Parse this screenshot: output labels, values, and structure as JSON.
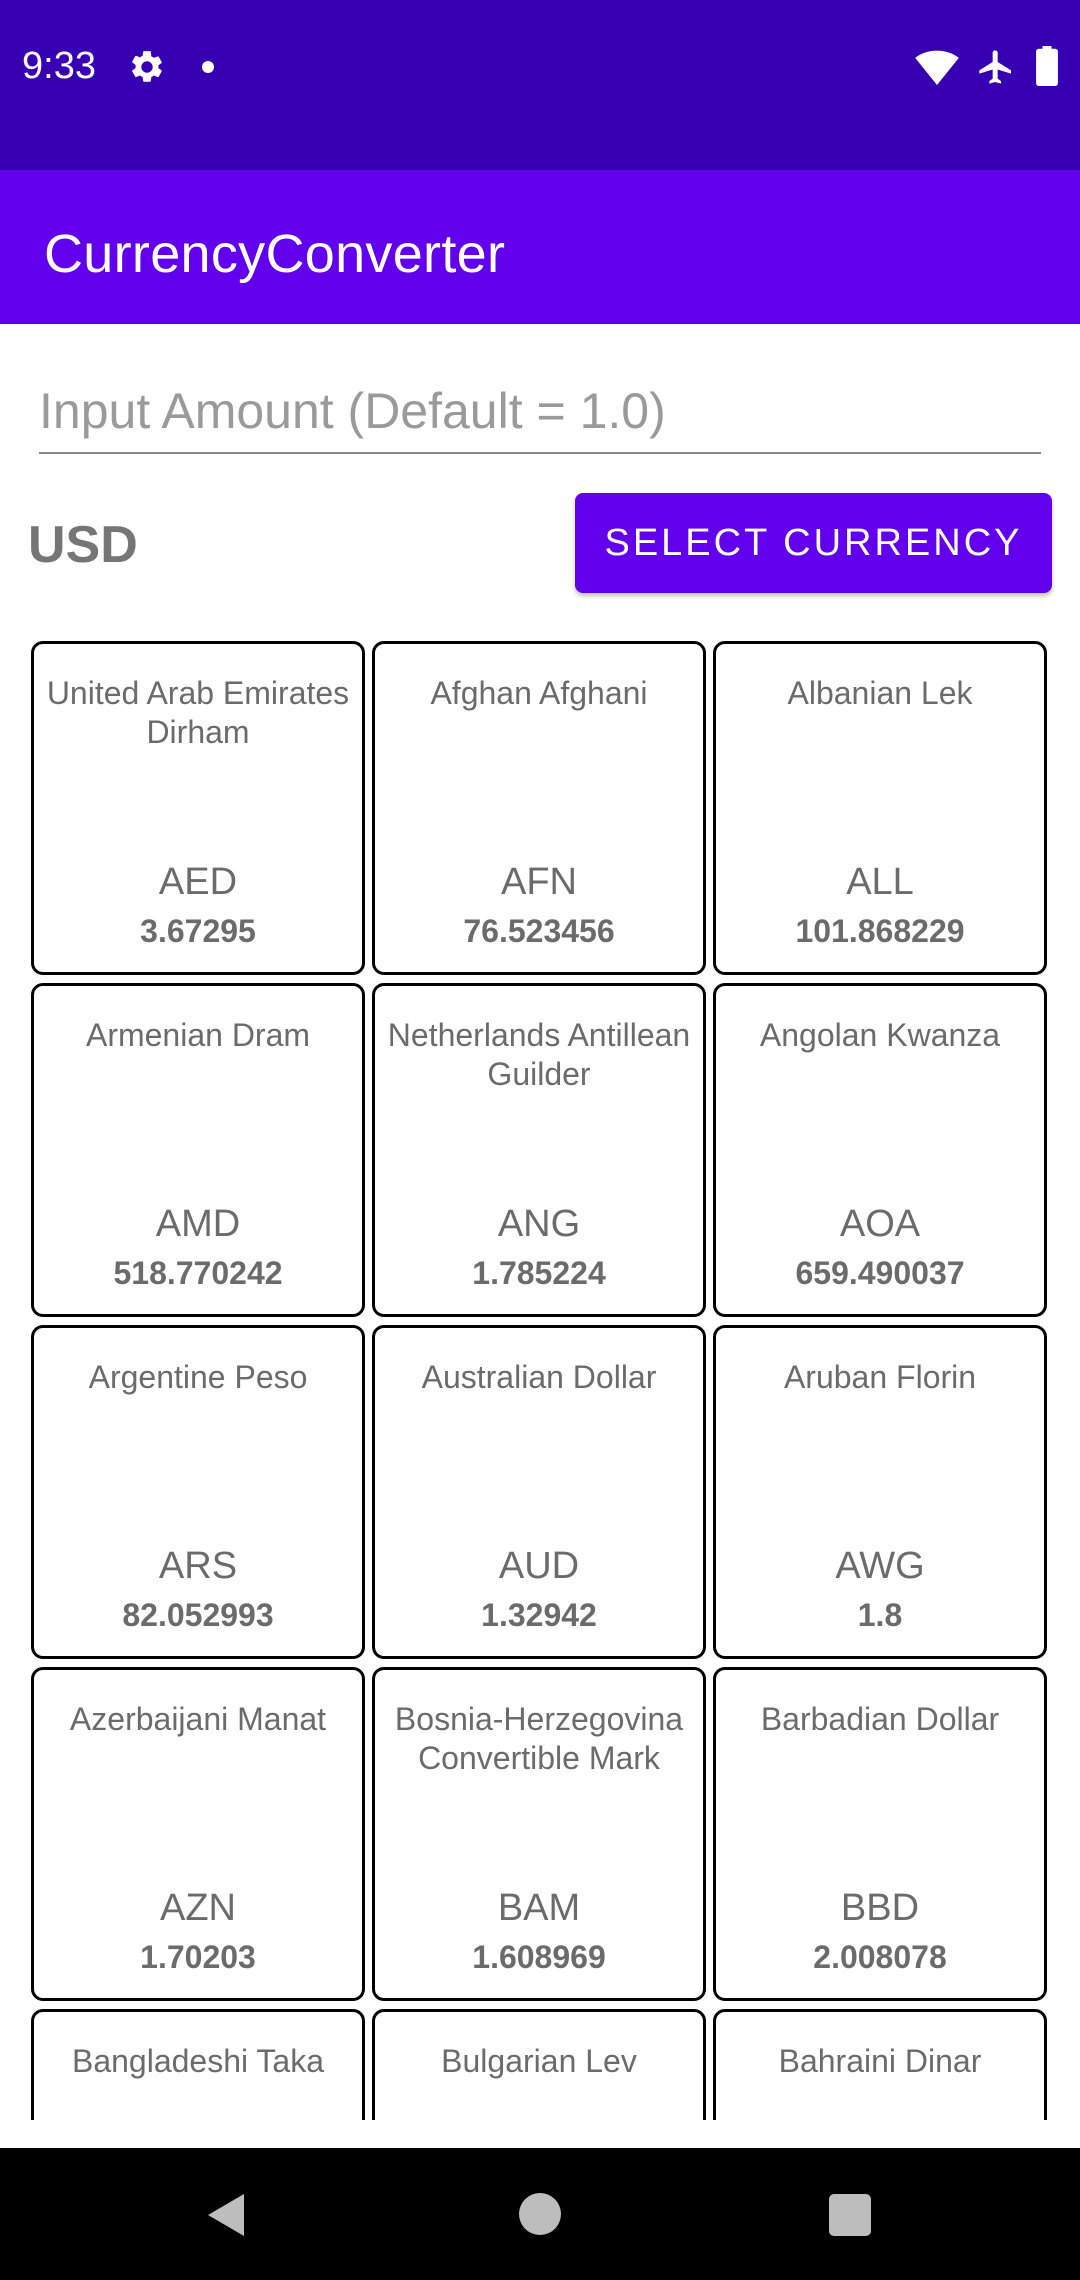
{
  "status_bar": {
    "time": "9:33",
    "icons": [
      "gear-icon",
      "notification-dot-icon",
      "wifi-icon",
      "airplane-icon",
      "battery-icon"
    ]
  },
  "app_bar": {
    "title": "CurrencyConverter"
  },
  "amount_input": {
    "value": "",
    "placeholder": "Input Amount (Default = 1.0)"
  },
  "base_currency": "USD",
  "select_button_label": "SELECT CURRENCY",
  "colors": {
    "status_bar": "#3700B3",
    "primary": "#6200EE",
    "text_gray": "#6b6b6b"
  },
  "currencies": [
    {
      "name": "United Arab Emirates Dirham",
      "code": "AED",
      "rate": "3.67295"
    },
    {
      "name": "Afghan Afghani",
      "code": "AFN",
      "rate": "76.523456"
    },
    {
      "name": "Albanian Lek",
      "code": "ALL",
      "rate": "101.868229"
    },
    {
      "name": "Armenian Dram",
      "code": "AMD",
      "rate": "518.770242"
    },
    {
      "name": "Netherlands Antillean Guilder",
      "code": "ANG",
      "rate": "1.785224"
    },
    {
      "name": "Angolan Kwanza",
      "code": "AOA",
      "rate": "659.490037"
    },
    {
      "name": "Argentine Peso",
      "code": "ARS",
      "rate": "82.052993"
    },
    {
      "name": "Australian Dollar",
      "code": "AUD",
      "rate": "1.32942"
    },
    {
      "name": "Aruban Florin",
      "code": "AWG",
      "rate": "1.8"
    },
    {
      "name": "Azerbaijani Manat",
      "code": "AZN",
      "rate": "1.70203"
    },
    {
      "name": "Bosnia-Herzegovina Convertible Mark",
      "code": "BAM",
      "rate": "1.608969"
    },
    {
      "name": "Barbadian Dollar",
      "code": "BBD",
      "rate": "2.008078"
    },
    {
      "name": "Bangladeshi Taka",
      "code": "",
      "rate": ""
    },
    {
      "name": "Bulgarian Lev",
      "code": "",
      "rate": ""
    },
    {
      "name": "Bahraini Dinar",
      "code": "",
      "rate": ""
    }
  ],
  "nav_bar": {
    "icons": [
      "back-icon",
      "home-icon",
      "recents-icon"
    ]
  }
}
